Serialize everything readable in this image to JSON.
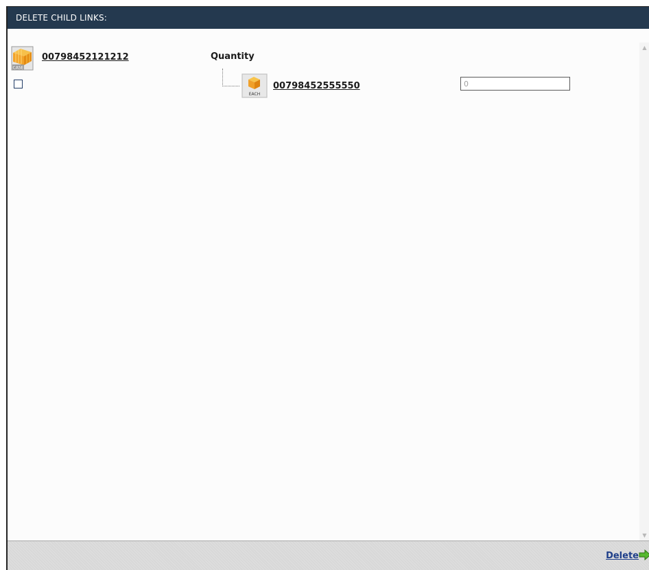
{
  "header": {
    "title": "DELETE CHILD LINKS:"
  },
  "parent": {
    "icon": "case-box-icon",
    "icon_badge": "CASE",
    "code": "00798452121212",
    "selected": false
  },
  "columns": {
    "quantity_label": "Quantity"
  },
  "child": {
    "icon": "each-box-icon",
    "icon_badge": "EACH",
    "code": "00798452555550",
    "quantity_value": "0"
  },
  "footer": {
    "delete_label": "Delete",
    "delete_icon": "green-arrow-right-icon"
  },
  "colors": {
    "header_bg": "#24394f",
    "footer_bg": "#d8d8d8",
    "link_blue": "#1f3f8a",
    "arrow_green": "#4aa82a"
  }
}
